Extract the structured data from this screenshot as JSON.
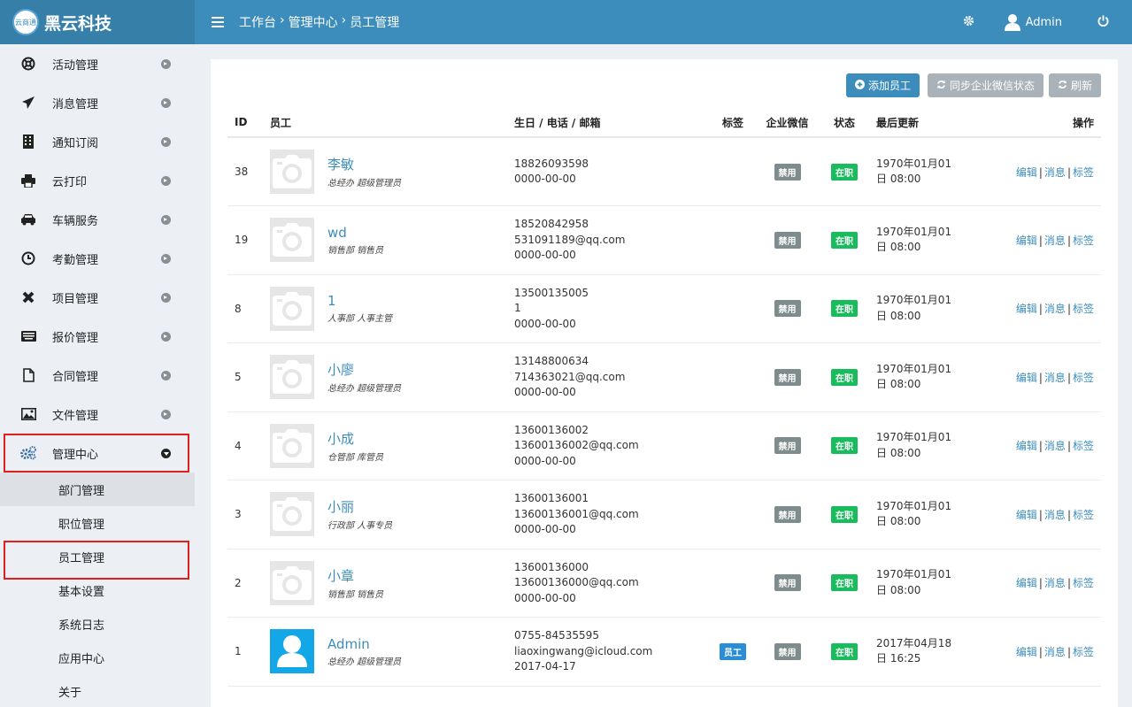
{
  "app": {
    "logo_badge": "云商通",
    "name": "黑云科技"
  },
  "topbar": {
    "breadcrumb": [
      "工作台",
      "›",
      "管理中心",
      "›",
      "员工管理"
    ],
    "user": "Admin"
  },
  "sidebar": {
    "items": [
      {
        "label": "活动管理",
        "icon": "lifebuoy-icon"
      },
      {
        "label": "消息管理",
        "icon": "paper-plane-icon"
      },
      {
        "label": "通知订阅",
        "icon": "building-icon"
      },
      {
        "label": "云打印",
        "icon": "printer-icon"
      },
      {
        "label": "车辆服务",
        "icon": "car-icon"
      },
      {
        "label": "考勤管理",
        "icon": "clock-icon"
      },
      {
        "label": "项目管理",
        "icon": "joomla-icon"
      },
      {
        "label": "报价管理",
        "icon": "keyboard-icon"
      },
      {
        "label": "合同管理",
        "icon": "file-icon"
      },
      {
        "label": "文件管理",
        "icon": "image-icon"
      },
      {
        "label": "管理中心",
        "icon": "cogs-icon"
      }
    ],
    "submenu": [
      "部门管理",
      "职位管理",
      "员工管理",
      "基本设置",
      "系统日志",
      "应用中心",
      "关于"
    ]
  },
  "toolbar": {
    "add": "添加员工",
    "sync": "同步企业微信状态",
    "refresh": "刷新"
  },
  "table": {
    "headers": {
      "id": "ID",
      "employee": "员工",
      "contact": "生日 / 电话 / 邮箱",
      "tag": "标签",
      "wechat": "企业微信",
      "status": "状态",
      "updated": "最后更新",
      "ops": "操作"
    },
    "ops": {
      "edit": "编辑",
      "message": "消息",
      "tag": "标签",
      "sep": "|"
    },
    "rows": [
      {
        "id": "38",
        "name": "李敏",
        "dept": "总经办 超级管理员",
        "phone": "18826093598",
        "email": "",
        "birthday": "0000-00-00",
        "tag": "",
        "wechat": "禁用",
        "status": "在职",
        "updated_1": "1970年01月01",
        "updated_2": "日 08:00"
      },
      {
        "id": "19",
        "name": "wd",
        "dept": "销售部 销售员",
        "phone": "18520842958",
        "email": "531091189@qq.com",
        "birthday": "0000-00-00",
        "tag": "",
        "wechat": "禁用",
        "status": "在职",
        "updated_1": "1970年01月01",
        "updated_2": "日 08:00"
      },
      {
        "id": "8",
        "name": "1",
        "dept": "人事部 人事主管",
        "phone": "13500135005",
        "email": "1",
        "birthday": "0000-00-00",
        "tag": "",
        "wechat": "禁用",
        "status": "在职",
        "updated_1": "1970年01月01",
        "updated_2": "日 08:00"
      },
      {
        "id": "5",
        "name": "小廖",
        "dept": "总经办 超级管理员",
        "phone": "13148800634",
        "email": "714363021@qq.com",
        "birthday": "0000-00-00",
        "tag": "",
        "wechat": "禁用",
        "status": "在职",
        "updated_1": "1970年01月01",
        "updated_2": "日 08:00"
      },
      {
        "id": "4",
        "name": "小成",
        "dept": "仓管部 库管员",
        "phone": "13600136002",
        "email": "13600136002@qq.com",
        "birthday": "0000-00-00",
        "tag": "",
        "wechat": "禁用",
        "status": "在职",
        "updated_1": "1970年01月01",
        "updated_2": "日 08:00"
      },
      {
        "id": "3",
        "name": "小丽",
        "dept": "行政部 人事专员",
        "phone": "13600136001",
        "email": "13600136001@qq.com",
        "birthday": "0000-00-00",
        "tag": "",
        "wechat": "禁用",
        "status": "在职",
        "updated_1": "1970年01月01",
        "updated_2": "日 08:00"
      },
      {
        "id": "2",
        "name": "小章",
        "dept": "销售部 销售员",
        "phone": "13600136000",
        "email": "13600136000@qq.com",
        "birthday": "0000-00-00",
        "tag": "",
        "wechat": "禁用",
        "status": "在职",
        "updated_1": "1970年01月01",
        "updated_2": "日 08:00"
      },
      {
        "id": "1",
        "name": "Admin",
        "dept": "总经办 超级管理员",
        "phone": "0755-84535595",
        "email": "liaoxingwang@icloud.com",
        "birthday": "2017-04-17",
        "tag": "员工",
        "wechat": "禁用",
        "status": "在职",
        "updated_1": "2017年04月18",
        "updated_2": "日 16:25",
        "admin": true
      }
    ]
  },
  "colors": {
    "accent": "#3c8dbc",
    "status_green": "#18bc5c",
    "disabled_gray": "#7f8c8d",
    "highlight_red": "#e02020"
  }
}
